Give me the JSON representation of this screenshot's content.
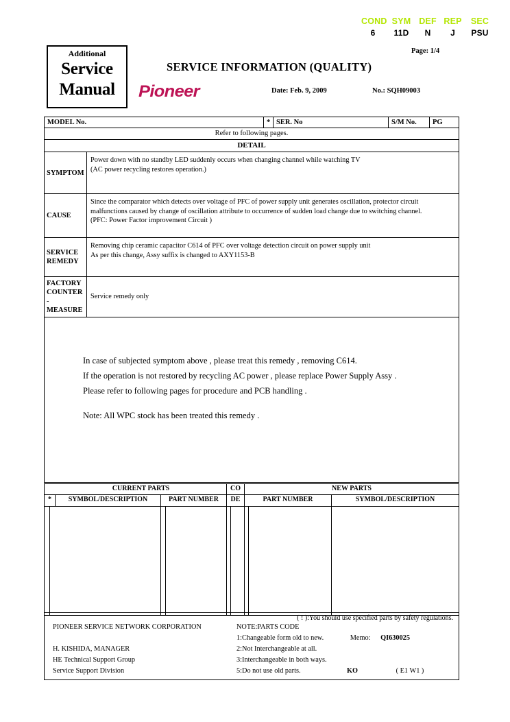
{
  "header": {
    "code_labels": [
      "COND",
      "SYM",
      "DEF",
      "REP",
      "SEC"
    ],
    "code_values": [
      "6",
      "11D",
      "N",
      "J",
      "PSU"
    ],
    "label_color": "#b3e600",
    "page_no": "Page: 1/4"
  },
  "masthead": {
    "line1": "Additional",
    "line2": "Service",
    "line3": "Manual",
    "doc_title": "SERVICE INFORMATION (QUALITY)",
    "brand": "Pioneer",
    "brand_color": "#bd1355",
    "date": "Date: Feb. 9, 2009",
    "number": "No.: SQH09003"
  },
  "info_table": {
    "model_no_label": "MODEL No.",
    "star": "*",
    "ser_no_label": "SER. No",
    "sm_no_label": "S/M No.",
    "pg_label": "PG",
    "refer": "Refer to following pages.",
    "detail": "DETAIL",
    "symptom_label": "SYMPTOM",
    "symptom_text_1": "Power down with no standby LED suddenly occurs when changing channel while watching TV",
    "symptom_text_2": "(AC power recycling restores operation.)",
    "cause_label": "CAUSE",
    "cause_text_1": "Since the comparator which detects over voltage of PFC of power supply unit generates oscillation, protector circuit",
    "cause_text_2": "malfunctions caused by change of oscillation attribute to occurrence of sudden load change due to switching channel.",
    "cause_text_3": "(PFC: Power Factor improvement Circuit )",
    "remedy_label_1": "SERVICE",
    "remedy_label_2": "REMEDY",
    "remedy_text_1": "Removing chip ceramic capacitor C614 of PFC over voltage detection circuit on power supply unit",
    "remedy_text_2": "As per this change, Assy suffix is changed to AXY1153-B",
    "factory_label_1": "FACTORY",
    "factory_label_2": "COUNTER",
    "factory_label_3": "-MEASURE",
    "factory_text": "Service remedy only"
  },
  "body": {
    "line1": "In case of subjected symptom above , please treat this remedy , removing C614.",
    "line2": "If the operation is not restored by recycling AC power , please replace Power Supply Assy .",
    "line3": "Please refer to following pages for procedure and PCB handling .",
    "line4": "Note: All WPC stock has been treated this remedy ."
  },
  "parts_table": {
    "star": "*",
    "current_parts": "CURRENT PARTS",
    "code_line1": "CO",
    "code_line2": "DE",
    "new_parts": "NEW PARTS",
    "sub_headers": {
      "cur_symbol": "SYMBOL/DESCRIPTION",
      "cur_part_number": "PART NUMBER",
      "new_part_number": "PART NUMBER",
      "new_symbol": "SYMBOL/DESCRIPTION"
    },
    "rows": []
  },
  "footer": {
    "safety_note": "( ! ):You should use specified parts by safety regulations.",
    "company": "PIONEER  SERVICE NETWORK CORPORATION",
    "manager": "H. KISHIDA, MANAGER",
    "group": "HE Technical Support Group",
    "division": "Service Support Division",
    "note_title": "NOTE:PARTS CODE",
    "note_1": "1:Changeable form old to new.",
    "memo_label": "Memo:",
    "memo_value": "QI630025",
    "note_2": "2:Not Interchangeable at all.",
    "note_3": "3:Interchangeable in both ways.",
    "note_5": "5:Do not use old parts.",
    "ko": "KO",
    "region": "( E1   W1 )"
  }
}
